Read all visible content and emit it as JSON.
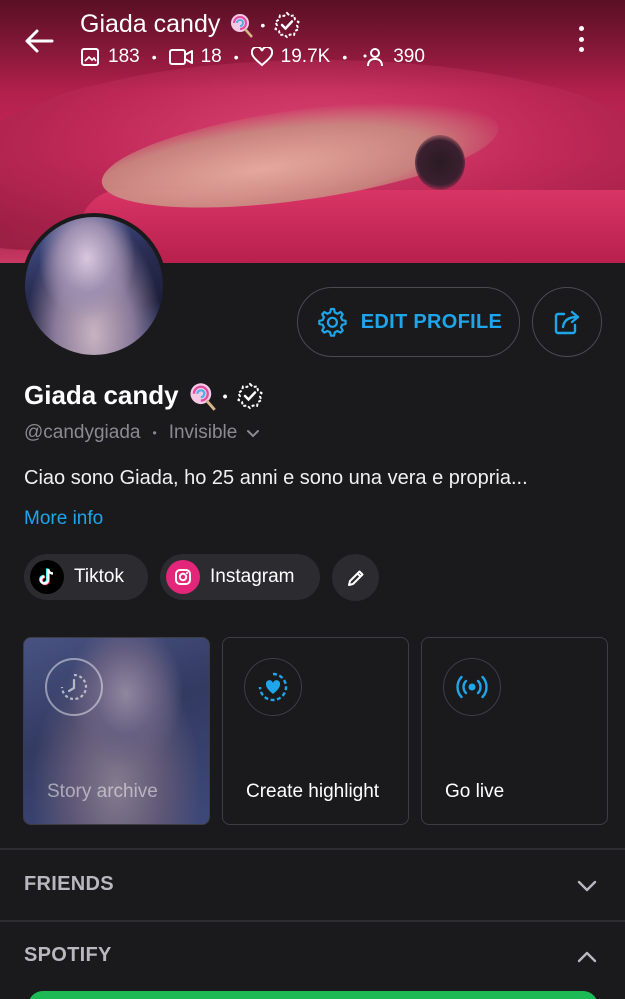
{
  "header": {
    "title": "Giada candy",
    "stats": {
      "photos": "183",
      "videos": "18",
      "likes": "19.7K",
      "fans": "390"
    }
  },
  "profile": {
    "name": "Giada candy",
    "handle": "@candygiada",
    "status": "Invisible",
    "bio": "Ciao sono Giada, ho 25 anni e sono una vera e propria...",
    "more_info": "More info"
  },
  "actions": {
    "edit_profile": "EDIT PROFILE"
  },
  "links": [
    {
      "label": "Tiktok"
    },
    {
      "label": "Instagram"
    }
  ],
  "cards": {
    "story_archive": "Story archive",
    "create_highlight": "Create highlight",
    "go_live": "Go live"
  },
  "sections": {
    "friends": "FRIENDS",
    "spotify": "SPOTIFY"
  },
  "colors": {
    "accent": "#1ea5ea",
    "background": "#1a1a1d",
    "instagram": "#e4267a",
    "spotify": "#1db954"
  },
  "icons": {
    "back": "arrow-left-icon",
    "more": "more-vertical-icon",
    "settings": "gear-icon",
    "share": "share-icon",
    "edit": "pencil-icon",
    "archive": "history-clock-icon",
    "highlight": "heart-circle-icon",
    "live": "broadcast-icon"
  }
}
